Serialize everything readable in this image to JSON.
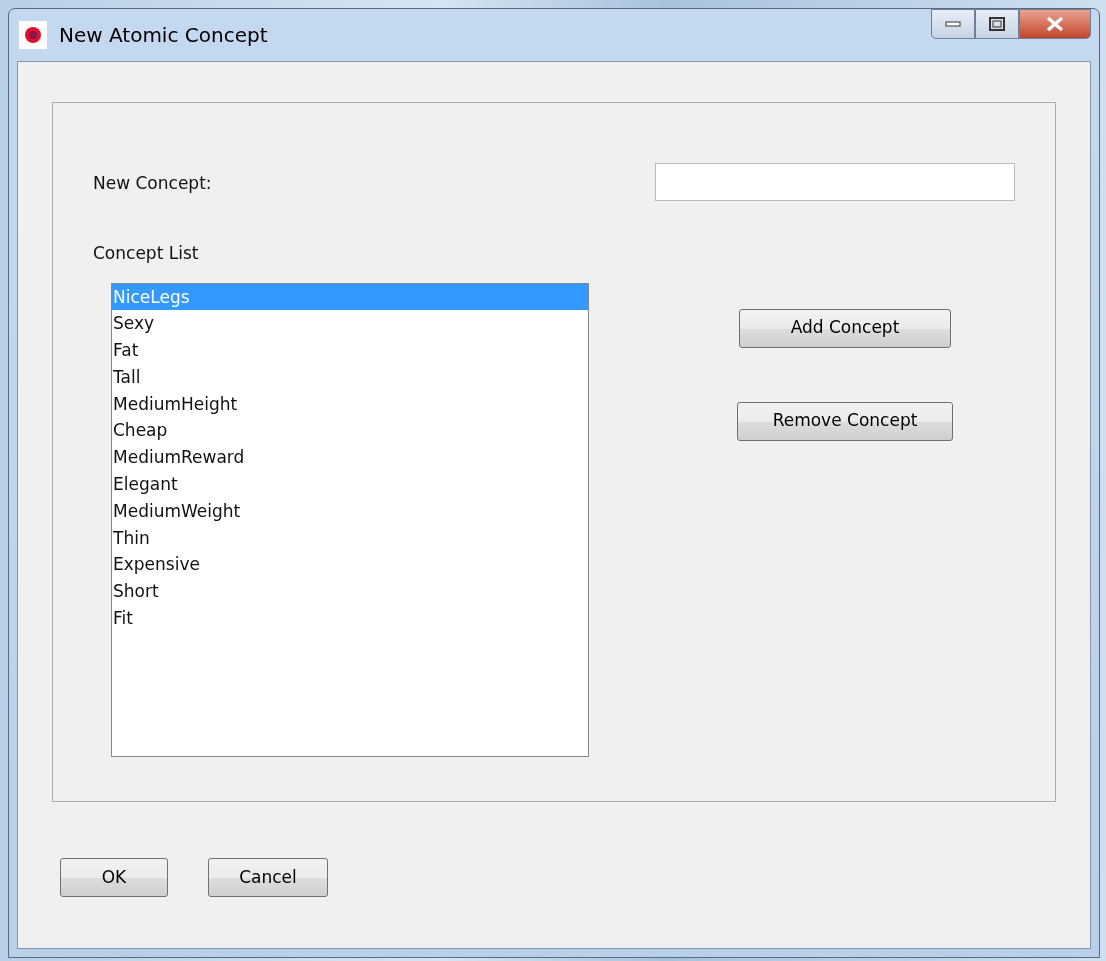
{
  "window": {
    "title": "New Atomic Concept"
  },
  "new_concept": {
    "label": "New Concept:"
  },
  "concept_list": {
    "label": "Concept List",
    "items": [
      {
        "text": "NiceLegs",
        "selected": true
      },
      {
        "text": "Sexy",
        "selected": false
      },
      {
        "text": "Fat",
        "selected": false
      },
      {
        "text": "Tall",
        "selected": false
      },
      {
        "text": "MediumHeight",
        "selected": false
      },
      {
        "text": "Cheap",
        "selected": false
      },
      {
        "text": "MediumReward",
        "selected": false
      },
      {
        "text": "Elegant",
        "selected": false
      },
      {
        "text": "MediumWeight",
        "selected": false
      },
      {
        "text": "Thin",
        "selected": false
      },
      {
        "text": "Expensive",
        "selected": false
      },
      {
        "text": "Short",
        "selected": false
      },
      {
        "text": "Fit",
        "selected": false
      }
    ]
  },
  "side_buttons": [
    "Add Concept",
    "Remove Concept"
  ],
  "buttons": [
    "OK",
    "Cancel"
  ]
}
